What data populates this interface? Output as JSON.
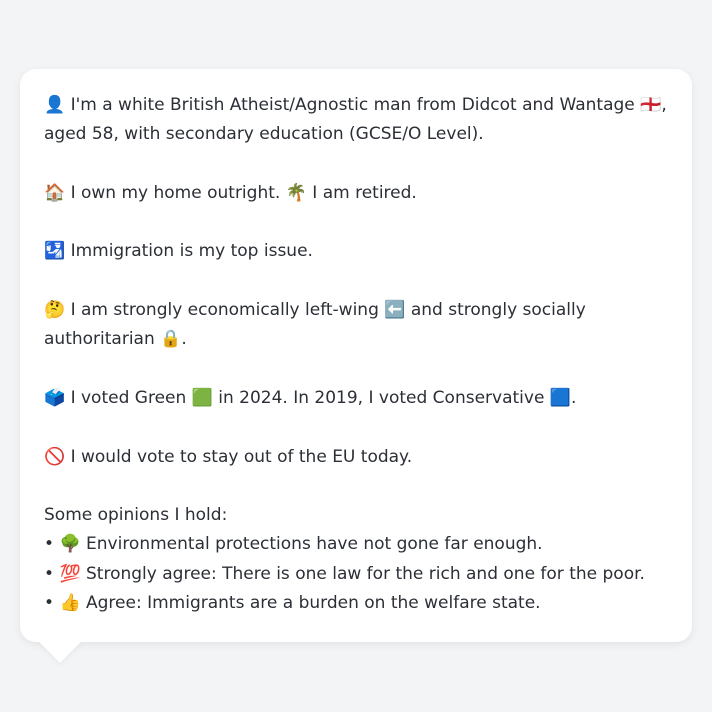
{
  "profile": {
    "identity_icon": "👤",
    "identity_text_1": "I'm a white British Atheist/Agnostic man from Didcot and Wantage",
    "identity_flag": "🏴󠁧󠁢󠁥󠁮󠁧󠁿",
    "identity_text_2": ", aged 58, with secondary education (GCSE/O Level).",
    "home_icon": "🏠",
    "home_text": "I own my home outright.",
    "retired_icon": "🌴",
    "retired_text": "I am retired.",
    "issue_icon": "🛂",
    "issue_text": "Immigration is my top issue.",
    "ideology_icon": "🤔",
    "ideology_text_1": "I am strongly economically left-wing",
    "left_icon": "⬅️",
    "ideology_text_2": "and strongly socially authoritarian",
    "lock_icon": "🔒",
    "ideology_end": ".",
    "vote_icon": "🗳️",
    "vote_text_1": "I voted Green",
    "green_icon": "🟩",
    "vote_text_2": "in 2024. In 2019, I voted Conservative",
    "blue_icon": "🟦",
    "vote_end": ".",
    "eu_icon": "🚫",
    "eu_text": "I would vote to stay out of the EU today.",
    "opinions_heading": "Some opinions I hold:",
    "bullet": "•",
    "opinions": [
      {
        "icon": "🌳",
        "text": "Environmental protections have not gone far enough."
      },
      {
        "icon": "💯",
        "text": "Strongly agree: There is one law for the rich and one for the poor."
      },
      {
        "icon": "👍",
        "text": "Agree: Immigrants are a burden on the welfare state."
      }
    ]
  }
}
